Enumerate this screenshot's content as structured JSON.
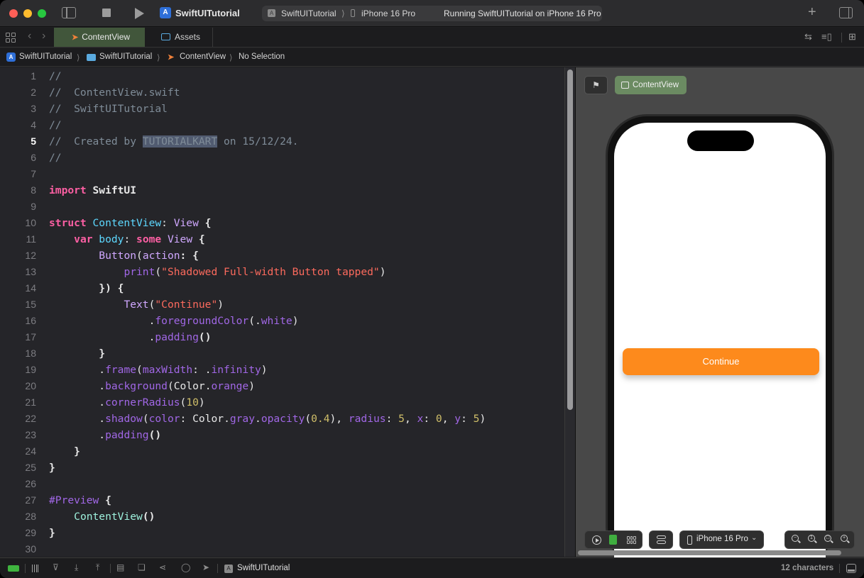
{
  "window": {
    "app_title": "SwiftUITutorial",
    "scheme": {
      "project": "SwiftUITutorial",
      "separator": "⟩",
      "device": "iPhone 16 Pro",
      "status": "Running SwiftUITutorial on iPhone 16 Pro"
    },
    "icons": {
      "sidebar_toggle": "sidebar-left-icon",
      "stop": "stop-icon",
      "run": "play-icon",
      "add": "plus-icon",
      "inspector_toggle": "sidebar-right-icon"
    }
  },
  "tabs": {
    "items": [
      {
        "label": "ContentView",
        "icon": "swift-file-icon",
        "active": true
      },
      {
        "label": "Assets",
        "icon": "asset-catalog-icon",
        "active": false
      }
    ],
    "nav_back": "‹",
    "nav_forward": "›",
    "right_icons": [
      "arrows-swap-icon",
      "editor-options-icon",
      "add-editor-icon"
    ]
  },
  "breadcrumb": {
    "items": [
      "SwiftUITutorial",
      "SwiftUITutorial",
      "ContentView",
      "No Selection"
    ],
    "separator": "⟩"
  },
  "editor": {
    "current_line": 5,
    "selection": "TUTORIALKART",
    "lines": [
      {
        "n": "1"
      },
      {
        "n": "2"
      },
      {
        "n": "3"
      },
      {
        "n": "4"
      },
      {
        "n": "5"
      },
      {
        "n": "6"
      },
      {
        "n": "7"
      },
      {
        "n": "8"
      },
      {
        "n": "9"
      },
      {
        "n": "10"
      },
      {
        "n": "11"
      },
      {
        "n": "12"
      },
      {
        "n": "13"
      },
      {
        "n": "14"
      },
      {
        "n": "15"
      },
      {
        "n": "16"
      },
      {
        "n": "17"
      },
      {
        "n": "18"
      },
      {
        "n": "19"
      },
      {
        "n": "20"
      },
      {
        "n": "21"
      },
      {
        "n": "22"
      },
      {
        "n": "23"
      },
      {
        "n": "24"
      },
      {
        "n": "25"
      },
      {
        "n": "26"
      },
      {
        "n": "27"
      },
      {
        "n": "28"
      },
      {
        "n": "29"
      },
      {
        "n": "30"
      }
    ],
    "code": {
      "l1": "//",
      "l2": "//  ContentView.swift",
      "l3": "//  SwiftUITutorial",
      "l4": "//",
      "l5_a": "//  Created by ",
      "l5_sel": "TUTORIALKART",
      "l5_b": " on 15/12/24.",
      "l6": "//",
      "l8_kw": "import",
      "l8_mod": " SwiftUI",
      "l10_kw": "struct",
      "l10_name": " ContentView",
      "l10_colon": ": ",
      "l10_type": "View",
      "l10_brace": " {",
      "l11_indent": "    ",
      "l11_kw": "var",
      "l11_name": " body",
      "l11_colon": ": ",
      "l11_kw2": "some",
      "l11_type": " View",
      "l11_brace": " {",
      "l12_indent": "        ",
      "l12_type": "Button",
      "l12_p": "(",
      "l12_arg": "action",
      "l12_rest": ": {",
      "l13_indent": "            ",
      "l13_fn": "print",
      "l13_p": "(",
      "l13_str": "\"Shadowed Full-width Button tapped\"",
      "l13_close": ")",
      "l14": "        }) {",
      "l15_indent": "            ",
      "l15_type": "Text",
      "l15_p": "(",
      "l15_str": "\"Continue\"",
      "l15_close": ")",
      "l16_indent": "                ",
      "l16_dot": ".",
      "l16_fn": "foregroundColor",
      "l16_p": "(.",
      "l16_val": "white",
      "l16_close": ")",
      "l17_indent": "                ",
      "l17_dot": ".",
      "l17_fn": "padding",
      "l17_close": "()",
      "l18": "        }",
      "l19_indent": "        ",
      "l19_dot": ".",
      "l19_fn": "frame",
      "l19_p": "(",
      "l19_arg": "maxWidth",
      "l19_colon": ": .",
      "l19_val": "infinity",
      "l19_close": ")",
      "l20_indent": "        ",
      "l20_dot": ".",
      "l20_fn": "background",
      "l20_p": "(",
      "l20_type": "Color",
      "l20_dot2": ".",
      "l20_val": "orange",
      "l20_close": ")",
      "l21_indent": "        ",
      "l21_dot": ".",
      "l21_fn": "cornerRadius",
      "l21_p": "(",
      "l21_num": "10",
      "l21_close": ")",
      "l22_indent": "        ",
      "l22_dot": ".",
      "l22_fn": "shadow",
      "l22_p": "(",
      "l22_arg1": "color",
      "l22_c1": ": ",
      "l22_type": "Color",
      "l22_dot2": ".",
      "l22_val": "gray",
      "l22_dot3": ".",
      "l22_fn2": "opacity",
      "l22_p2": "(",
      "l22_num1": "0.4",
      "l22_c2": "), ",
      "l22_arg2": "radius",
      "l22_c3": ": ",
      "l22_num2": "5",
      "l22_c4": ", ",
      "l22_arg3": "x",
      "l22_c5": ": ",
      "l22_num3": "0",
      "l22_c6": ", ",
      "l22_arg4": "y",
      "l22_c7": ": ",
      "l22_num4": "5",
      "l22_close": ")",
      "l23_indent": "        ",
      "l23_dot": ".",
      "l23_fn": "padding",
      "l23_close": "()",
      "l24": "    }",
      "l25": "}",
      "l27_macro": "#Preview",
      "l27_brace": " {",
      "l28_indent": "    ",
      "l28_name": "ContentView",
      "l28_close": "()",
      "l29": "}"
    }
  },
  "canvas": {
    "pin_icon": "⚑",
    "preview_label": "ContentView",
    "app_button_label": "Continue",
    "app_button_color": "#fd8a1c",
    "device_label": "iPhone 16 Pro",
    "device_chevron": "⌄",
    "toolbar_icons": [
      "live-preview-icon",
      "selectable-icon",
      "variants-icon",
      "canvas-settings-icon",
      "zoom-out-icon",
      "zoom-100-icon",
      "zoom-fit-icon",
      "zoom-in-icon"
    ]
  },
  "statusbar": {
    "scheme": "SwiftUITutorial",
    "char_count": "12 characters",
    "icons": [
      "battery-icon",
      "pause-icon",
      "step-over-icon",
      "step-into-icon",
      "step-out-icon",
      "view-debugger-icon",
      "memory-graph-icon",
      "share-icon",
      "environment-icon",
      "location-icon",
      "debug-area-icon"
    ]
  }
}
